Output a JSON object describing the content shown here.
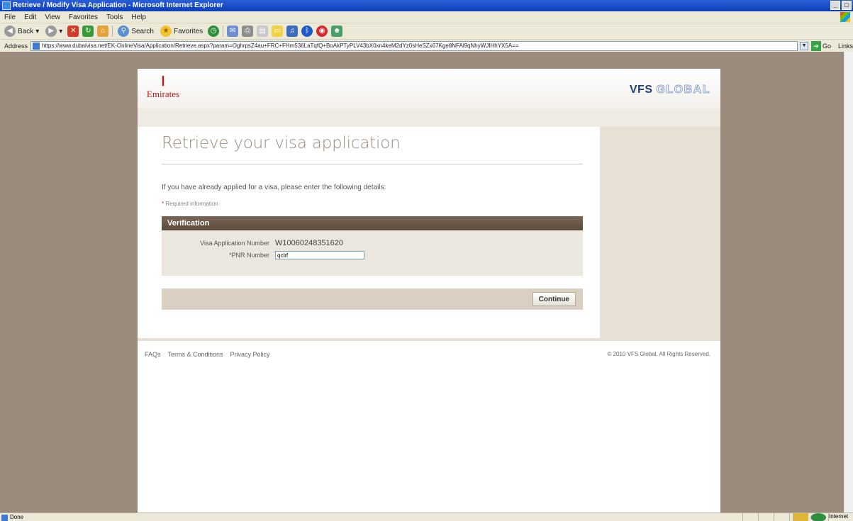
{
  "window": {
    "title": "Retrieve / Modify Visa Application - Microsoft Internet Explorer"
  },
  "menu": [
    "File",
    "Edit",
    "View",
    "Favorites",
    "Tools",
    "Help"
  ],
  "toolbar": {
    "back": "Back",
    "search": "Search",
    "favorites": "Favorites"
  },
  "address": {
    "label": "Address",
    "url": "https://www.dubaivisa.net/EK-OnlineVisa/Application/Retrieve.aspx?param=OghrpsZ4au+FRC+FHm536LaTqfQ+BoAkPTyPLV43bX0xn4keM2dYz0sHeSZx67Kge8NFAl9qNhyWJIHhYX5A==",
    "go": "Go",
    "links": "Links"
  },
  "brand": {
    "emirates": "Emirates",
    "vfs_a": "VFS",
    "vfs_b": "GLOBAL"
  },
  "main": {
    "heading": "Retrieve your visa application",
    "intro": "If you have already applied for a visa, please enter the following details:",
    "required_star": "*",
    "required_text": "Required information",
    "section_title": "Verification",
    "app_number_label": "Visa Application Number",
    "app_number_value": "W10060248351620",
    "pnr_label": "*PNR Number",
    "pnr_value": "qclrf",
    "continue_label": "Continue"
  },
  "footer": {
    "faqs": "FAQs",
    "terms": "Terms & Conditions",
    "privacy": "Privacy Policy",
    "copyright": "© 2010 VFS Global. All Rights Reserved."
  },
  "status": {
    "text": "Done",
    "zone": "Internet"
  }
}
